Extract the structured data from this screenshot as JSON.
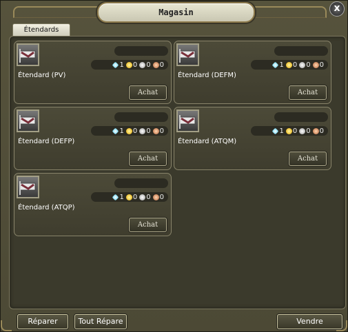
{
  "window": {
    "title": "Magasin",
    "close_label": "x"
  },
  "tabs": [
    {
      "label": "Étendards"
    }
  ],
  "items": [
    {
      "name": "Étendard (PV)",
      "buy_label": "Achat",
      "price": {
        "diamond": "1",
        "gold": "0",
        "silver": "0",
        "copper": "0"
      }
    },
    {
      "name": "Étendard (DEFM)",
      "buy_label": "Achat",
      "price": {
        "diamond": "1",
        "gold": "0",
        "silver": "0",
        "copper": "0"
      }
    },
    {
      "name": "Étendard (DEFP)",
      "buy_label": "Achat",
      "price": {
        "diamond": "1",
        "gold": "0",
        "silver": "0",
        "copper": "0"
      }
    },
    {
      "name": "Étendard (ATQM)",
      "buy_label": "Achat",
      "price": {
        "diamond": "1",
        "gold": "0",
        "silver": "0",
        "copper": "0"
      }
    },
    {
      "name": "Étendard (ATQP)",
      "buy_label": "Achat",
      "price": {
        "diamond": "1",
        "gold": "0",
        "silver": "0",
        "copper": "0"
      }
    }
  ],
  "footer": {
    "repair_label": "Réparer",
    "repair_all_label": "Tout Répare",
    "sell_label": "Vendre"
  },
  "icons": {
    "item": "banner-icon",
    "currency": [
      "diamond-icon",
      "gold-coin-icon",
      "silver-coin-icon",
      "copper-coin-icon"
    ]
  },
  "colors": {
    "panel": "#3b3a2c",
    "frame": "#89846a",
    "title_plate": "#e8e6d2"
  }
}
